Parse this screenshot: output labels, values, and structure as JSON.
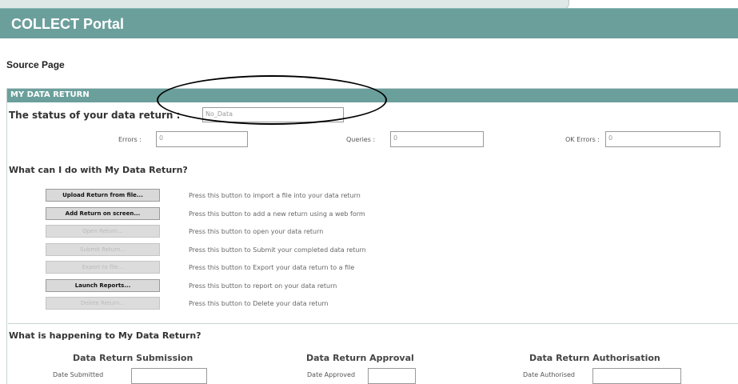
{
  "app": {
    "title": "COLLECT Portal"
  },
  "page": {
    "source_label": "Source Page"
  },
  "panel": {
    "title": "MY DATA RETURN"
  },
  "status": {
    "label": "The status of your data return :",
    "value": "No_Data"
  },
  "counts": {
    "errors_label": "Errors :",
    "errors_value": "0",
    "queries_label": "Queries :",
    "queries_value": "0",
    "ok_errors_label": "OK Errors :",
    "ok_errors_value": "0"
  },
  "actions": {
    "title": "What can I do with My Data Return?",
    "items": [
      {
        "label": "Upload Return from file...",
        "enabled": true,
        "description": "Press this button to import a file into your data return"
      },
      {
        "label": "Add Return on screen...",
        "enabled": true,
        "description": "Press this button to add a new return using a web form"
      },
      {
        "label": "Open Return...",
        "enabled": false,
        "description": "Press this button to open your data return"
      },
      {
        "label": "Submit Return...",
        "enabled": false,
        "description": "Press this button to Submit your completed data return"
      },
      {
        "label": "Export to file...",
        "enabled": false,
        "description": "Press this button to Export your data return to a file"
      },
      {
        "label": "Launch Reports...",
        "enabled": true,
        "description": "Press this button to report on your data return"
      },
      {
        "label": "Delete Return...",
        "enabled": false,
        "description": "Press this button to Delete your data return"
      }
    ]
  },
  "happening": {
    "title": "What is happening to My Data Return?",
    "submission": {
      "title": "Data Return Submission",
      "date_label": "Date Submitted",
      "date_value": ""
    },
    "approval": {
      "title": "Data Return Approval",
      "date_label": "Date Approved",
      "date_value": ""
    },
    "authorisation": {
      "title": "Data Return Authorisation",
      "date_label": "Date Authorised",
      "date_value": ""
    }
  }
}
